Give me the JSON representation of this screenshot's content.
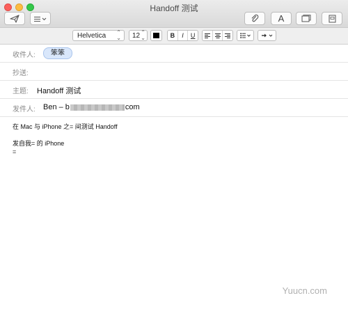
{
  "window": {
    "title": "Handoff 测试"
  },
  "format": {
    "font": "Helvetica",
    "size": "12",
    "bold": "B",
    "italic": "I",
    "underline": "U"
  },
  "header": {
    "to_label": "收件人:",
    "to_token": "笨笨",
    "cc_label": "抄送:",
    "subject_label": "主题:",
    "subject_value": "Handoff 测试",
    "from_label": "发件人:",
    "from_prefix": "Ben – b",
    "from_suffix": "com"
  },
  "body": {
    "line1": "在 Mac 与 iPhone 之= 间测试 Handoff",
    "line2": "",
    "line3": "发自我= 的 iPhone",
    "line4": "="
  },
  "watermark": {
    "text": "Yuucn.com"
  },
  "colors": {
    "token_bg": "#d9e7fb",
    "close": "#fc605c",
    "minimize": "#fdbc40",
    "zoom": "#34c84a"
  }
}
